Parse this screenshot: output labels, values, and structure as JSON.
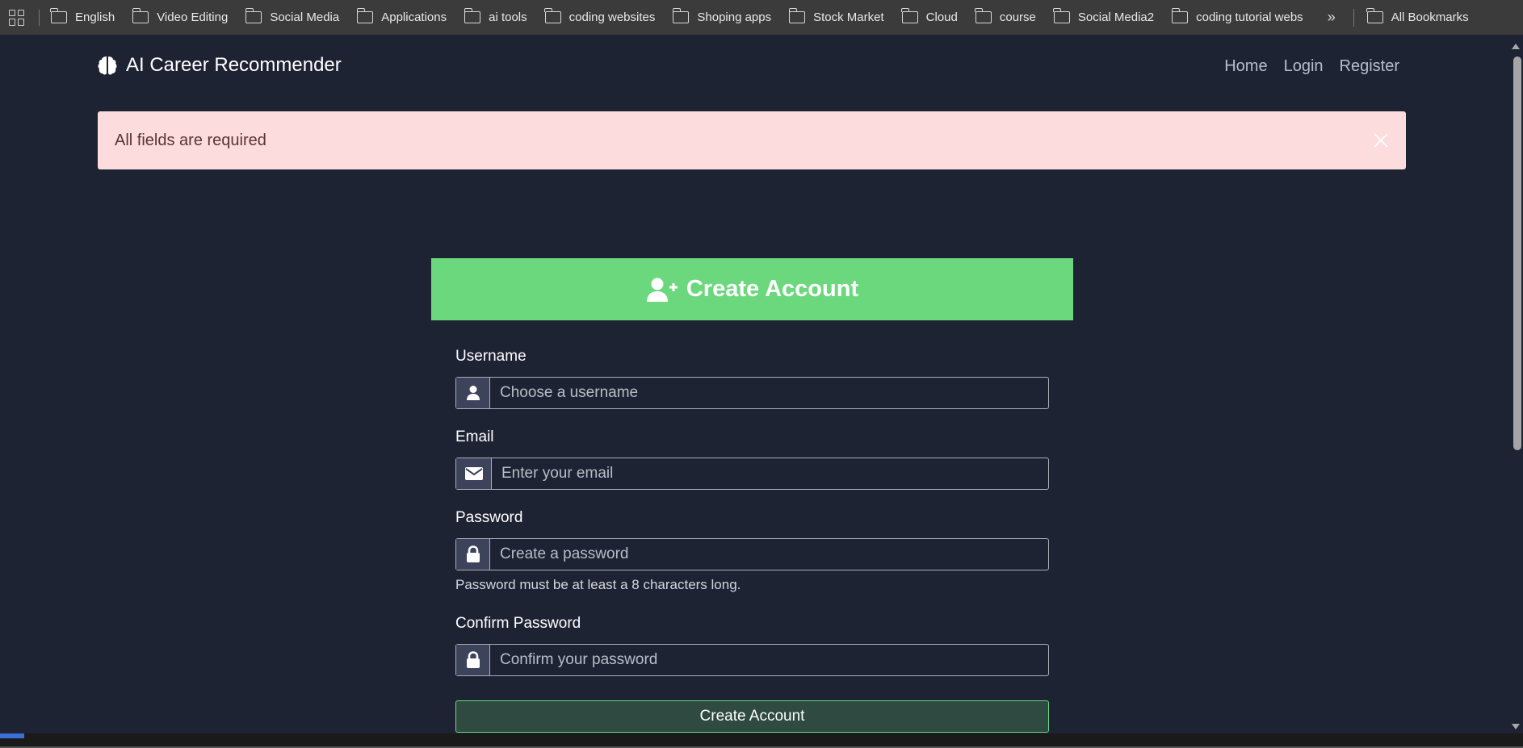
{
  "bookmarks": {
    "items": [
      "English",
      "Video Editing",
      "Social Media",
      "Applications",
      "ai tools",
      "coding websites",
      "Shoping apps",
      "Stock Market",
      "Cloud",
      "course",
      "Social Media2",
      "coding tutorial webs"
    ],
    "more": "»",
    "all": "All Bookmarks"
  },
  "nav": {
    "brand": "AI Career Recommender",
    "links": [
      "Home",
      "Login",
      "Register"
    ]
  },
  "alert": {
    "message": "All fields are required"
  },
  "form": {
    "title": "Create Account",
    "username_label": "Username",
    "username_placeholder": "Choose a username",
    "email_label": "Email",
    "email_placeholder": "Enter your email",
    "password_label": "Password",
    "password_placeholder": "Create a password",
    "password_hint": "Password must be at least a 8 characters long.",
    "confirm_label": "Confirm Password",
    "confirm_placeholder": "Confirm your password",
    "submit_label": "Create Account"
  },
  "colors": {
    "background": "#1e2334",
    "header_green": "#6cd87e",
    "alert_bg": "#fcdcdd"
  }
}
